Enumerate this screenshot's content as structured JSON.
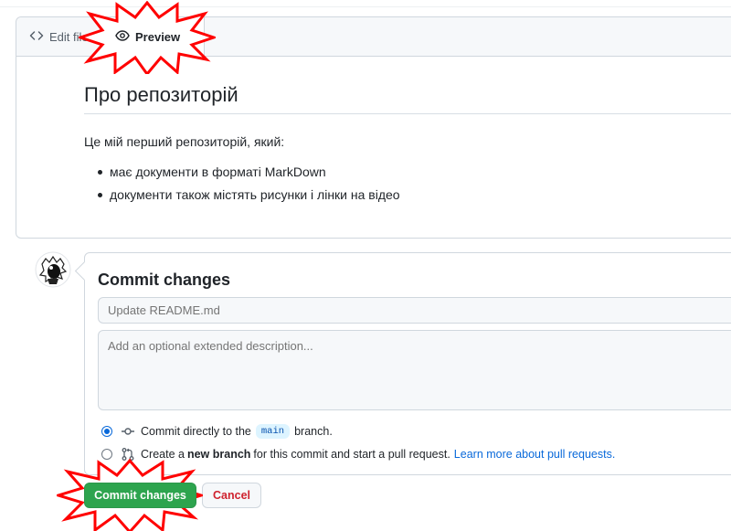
{
  "editor": {
    "tabs": {
      "edit_label": "Edit file",
      "preview_label": "Preview"
    }
  },
  "preview": {
    "title": "Про репозиторій",
    "intro": "Це мій перший репозиторій, який:",
    "list": [
      "має документи в форматі MarkDown",
      "документи також містять рисунки і лінки на відео"
    ]
  },
  "commit": {
    "title": "Commit changes",
    "summary_placeholder": "Update README.md",
    "description_placeholder": "Add an optional extended description...",
    "option_direct": {
      "prefix": "Commit directly to the",
      "branch": "main",
      "suffix": "branch.",
      "selected": true
    },
    "option_new_branch": {
      "prefix": "Create a",
      "bold": "new branch",
      "suffix": "for this commit and start a pull request.",
      "link": "Learn more about pull requests.",
      "selected": false
    },
    "commit_button": "Commit changes",
    "cancel_button": "Cancel"
  },
  "colors": {
    "accent_blue": "#0969da",
    "commit_green": "#2da44e",
    "cancel_red": "#cf222e",
    "highlight_burst": "#ff0000"
  }
}
